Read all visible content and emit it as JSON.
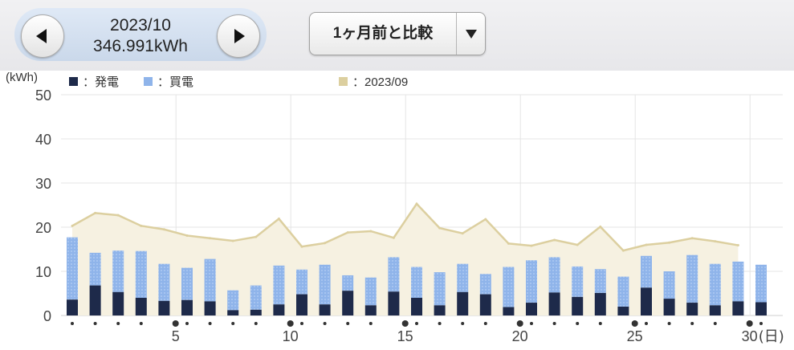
{
  "header": {
    "month_label": "2023/10",
    "total_label": "346.991kWh",
    "compare_label": "1ヶ月前と比較"
  },
  "legend": {
    "unit": "(kWh)",
    "generation": "：発電",
    "purchase": "：買電",
    "previous": "：2023/09"
  },
  "colors": {
    "generation": "#1e2a4a",
    "purchase": "#8fb4ea",
    "previous_line": "#dccf9f",
    "previous_fill": "#f6f1e1"
  },
  "chart_data": {
    "type": "bar",
    "ylim": [
      0,
      50
    ],
    "yticks": [
      "50",
      "40",
      "30",
      "20",
      "10",
      "0"
    ],
    "xtick_labels": [
      "5",
      "10",
      "15",
      "20",
      "25",
      "30"
    ],
    "day_suffix": "(日)",
    "days": [
      1,
      2,
      3,
      4,
      5,
      6,
      7,
      8,
      9,
      10,
      11,
      12,
      13,
      14,
      15,
      16,
      17,
      18,
      19,
      20,
      21,
      22,
      23,
      24,
      25,
      26,
      27,
      28,
      29,
      30,
      31
    ],
    "weekend_days": [
      5,
      10,
      15,
      20,
      25,
      30
    ],
    "series": [
      {
        "name": "発電",
        "values": [
          3.6,
          6.8,
          5.3,
          4.0,
          3.3,
          3.5,
          3.2,
          1.2,
          1.3,
          2.5,
          4.8,
          2.5,
          5.6,
          2.3,
          5.4,
          4.0,
          2.3,
          5.3,
          4.8,
          1.9,
          2.9,
          5.2,
          4.2,
          5.1,
          2.0,
          6.3,
          3.8,
          2.9,
          2.3,
          3.2,
          3.0
        ]
      },
      {
        "name": "買電",
        "values": [
          14.1,
          7.4,
          9.4,
          10.6,
          8.4,
          7.3,
          9.6,
          4.5,
          5.5,
          8.8,
          5.6,
          9.0,
          3.5,
          6.3,
          7.8,
          7.0,
          7.5,
          6.4,
          4.6,
          9.1,
          9.6,
          8.0,
          6.9,
          5.4,
          6.8,
          7.2,
          6.2,
          10.8,
          9.4,
          9.0,
          8.5
        ]
      },
      {
        "name": "2023/09",
        "values": [
          20.3,
          23.2,
          22.7,
          20.3,
          19.5,
          18.1,
          17.5,
          16.9,
          17.8,
          21.9,
          15.6,
          16.4,
          18.8,
          19.1,
          17.6,
          25.3,
          19.8,
          18.6,
          21.8,
          16.3,
          15.8,
          17.1,
          16.0,
          20.1,
          14.7,
          16.0,
          16.5,
          17.5,
          16.8,
          15.9
        ]
      }
    ]
  }
}
